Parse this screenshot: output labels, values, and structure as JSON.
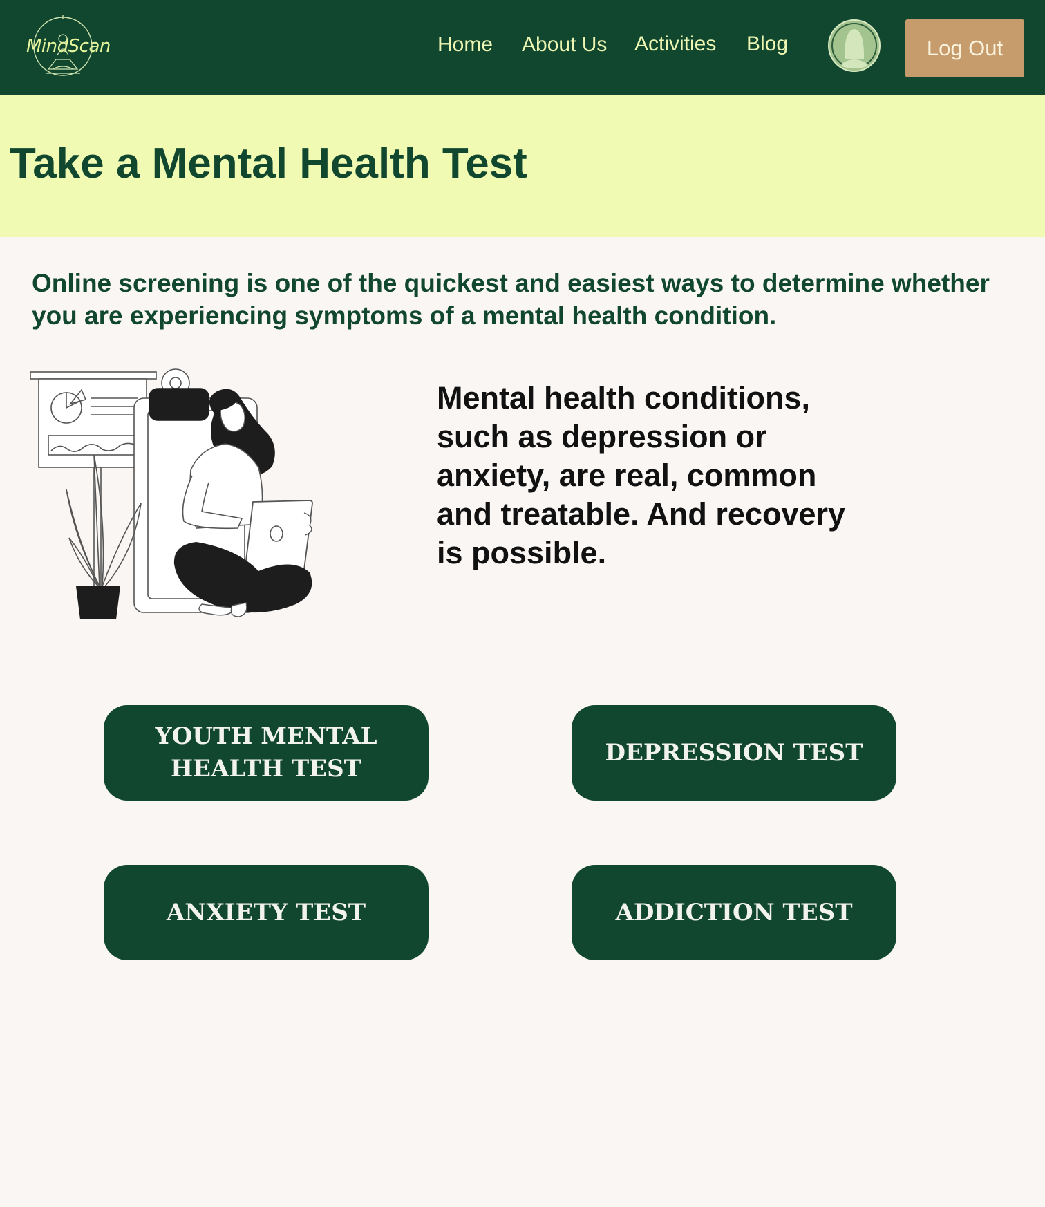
{
  "brand": {
    "name": "MindScan"
  },
  "nav": {
    "items": [
      {
        "label": "Home"
      },
      {
        "label": "About Us"
      },
      {
        "label": "Activities"
      },
      {
        "label": "Blog"
      }
    ],
    "logout_label": "Log Out"
  },
  "hero": {
    "title": "Take a Mental Health Test"
  },
  "intro": {
    "text": "Online screening is one of the quickest and easiest ways to determine whether you are experiencing symptoms of a mental health condition."
  },
  "message": {
    "text": "Mental health conditions, such as depression or anxiety, are real, common and treatable. And recovery is possible."
  },
  "tests": [
    {
      "label": "YOUTH MENTAL HEALTH TEST"
    },
    {
      "label": "DEPRESSION TEST"
    },
    {
      "label": "ANXIETY TEST"
    },
    {
      "label": "ADDICTION TEST"
    }
  ],
  "colors": {
    "nav_background": "#11472e",
    "hero_background": "#f1fab2",
    "page_background": "#faf6f4",
    "logout_button": "#c69c6d",
    "test_button": "#11472e",
    "nav_link_text": "#edf6b3",
    "avatar_fill": "#a3c48f"
  },
  "icons": {
    "logo": "meditation-person-logo",
    "avatar": "user-avatar-icon"
  }
}
